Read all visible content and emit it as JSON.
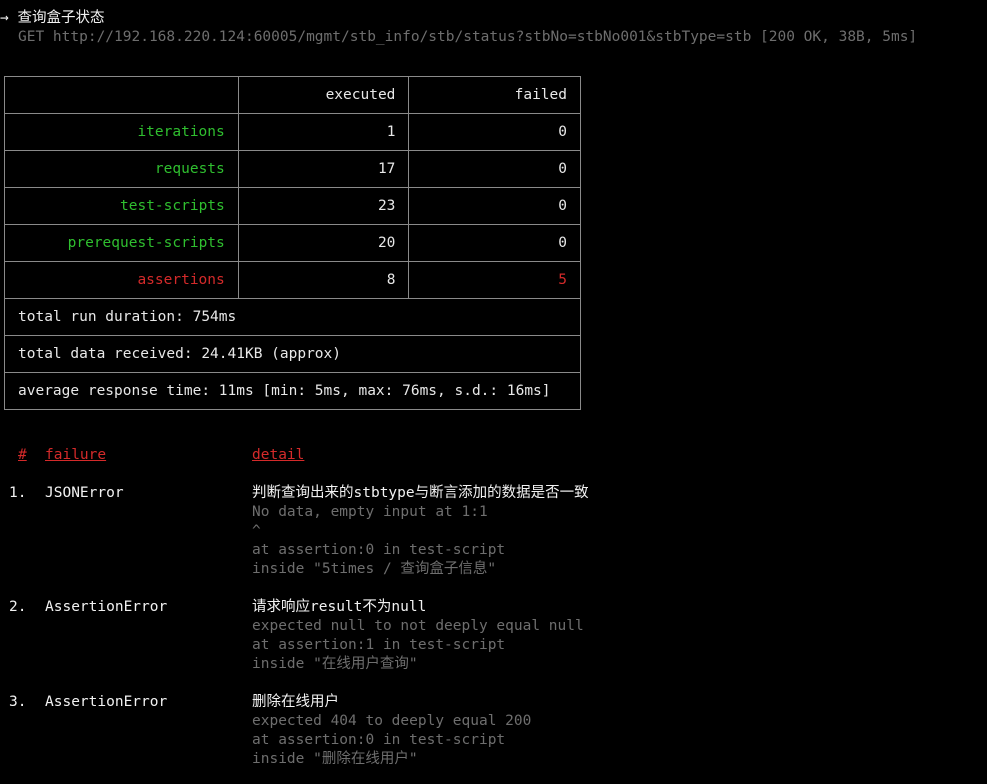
{
  "request": {
    "arrow": "→",
    "name": "查询盒子状态",
    "url_line": "GET http://192.168.220.124:60005/mgmt/stb_info/stb/status?stbNo=stbNo001&stbType=stb [200 OK, 38B, 5ms]"
  },
  "summary": {
    "header": {
      "executed": "executed",
      "failed": "failed"
    },
    "rows": [
      {
        "label": "iterations",
        "executed": "1",
        "failed": "0",
        "color": "#2fbf2f",
        "failed_color": "#e8e8e8"
      },
      {
        "label": "requests",
        "executed": "17",
        "failed": "0",
        "color": "#2fbf2f",
        "failed_color": "#e8e8e8"
      },
      {
        "label": "test-scripts",
        "executed": "23",
        "failed": "0",
        "color": "#2fbf2f",
        "failed_color": "#e8e8e8"
      },
      {
        "label": "prerequest-scripts",
        "executed": "20",
        "failed": "0",
        "color": "#2fbf2f",
        "failed_color": "#e8e8e8"
      },
      {
        "label": "assertions",
        "executed": "8",
        "failed": "5",
        "color": "#d42a2a",
        "failed_color": "#d42a2a"
      }
    ],
    "duration": "total run duration: 754ms",
    "data_received": "total data received: 24.41KB (approx)",
    "avg_response": "average response time: 11ms [min: 5ms, max: 76ms, s.d.: 16ms]"
  },
  "failures": {
    "header": {
      "hash": "#",
      "failure": "failure",
      "detail": "detail"
    },
    "items": [
      {
        "index": "1.",
        "type": "JSONError",
        "title": "判断查询出来的stbtype与断言添加的数据是否一致",
        "details": [
          "No data, empty input at 1:1",
          "^",
          "at assertion:0 in test-script",
          "inside \"5times / 查询盒子信息\""
        ]
      },
      {
        "index": "2.",
        "type": "AssertionError",
        "title": "请求响应result不为null",
        "details": [
          "expected null to not deeply equal null",
          "at assertion:1 in test-script",
          "inside \"在线用户查询\""
        ]
      },
      {
        "index": "3.",
        "type": "AssertionError",
        "title": "删除在线用户",
        "details": [
          "expected 404 to deeply equal 200",
          "at assertion:0 in test-script",
          "inside \"删除在线用户\""
        ]
      }
    ]
  },
  "colors": {
    "background": "#000000",
    "text": "#e8e8e8",
    "muted": "#6e6e6e",
    "success": "#2fbf2f",
    "error": "#d42a2a",
    "border": "#8a8a8a"
  }
}
